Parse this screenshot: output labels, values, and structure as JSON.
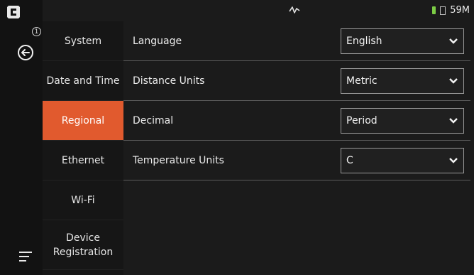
{
  "status": {
    "memory": "59M"
  },
  "rail": {
    "notification_count": "1"
  },
  "nav": {
    "items": [
      {
        "label": "System"
      },
      {
        "label": "Date and Time"
      },
      {
        "label": "Regional",
        "active": true
      },
      {
        "label": "Ethernet"
      },
      {
        "label": "Wi-Fi"
      },
      {
        "label_line1": "Device",
        "label_line2": "Registration"
      }
    ]
  },
  "settings": [
    {
      "label": "Language",
      "value": "English"
    },
    {
      "label": "Distance Units",
      "value": "Metric"
    },
    {
      "label": "Decimal",
      "value": "Period"
    },
    {
      "label": "Temperature Units",
      "value": "C"
    }
  ],
  "colors": {
    "accent": "#e15a2e",
    "battery": "#7ccc45"
  },
  "icons": [
    "app-logo-icon",
    "back-arrow-icon",
    "hamburger-menu-icon",
    "signal-icon",
    "battery-icon",
    "chevron-down-icon"
  ]
}
